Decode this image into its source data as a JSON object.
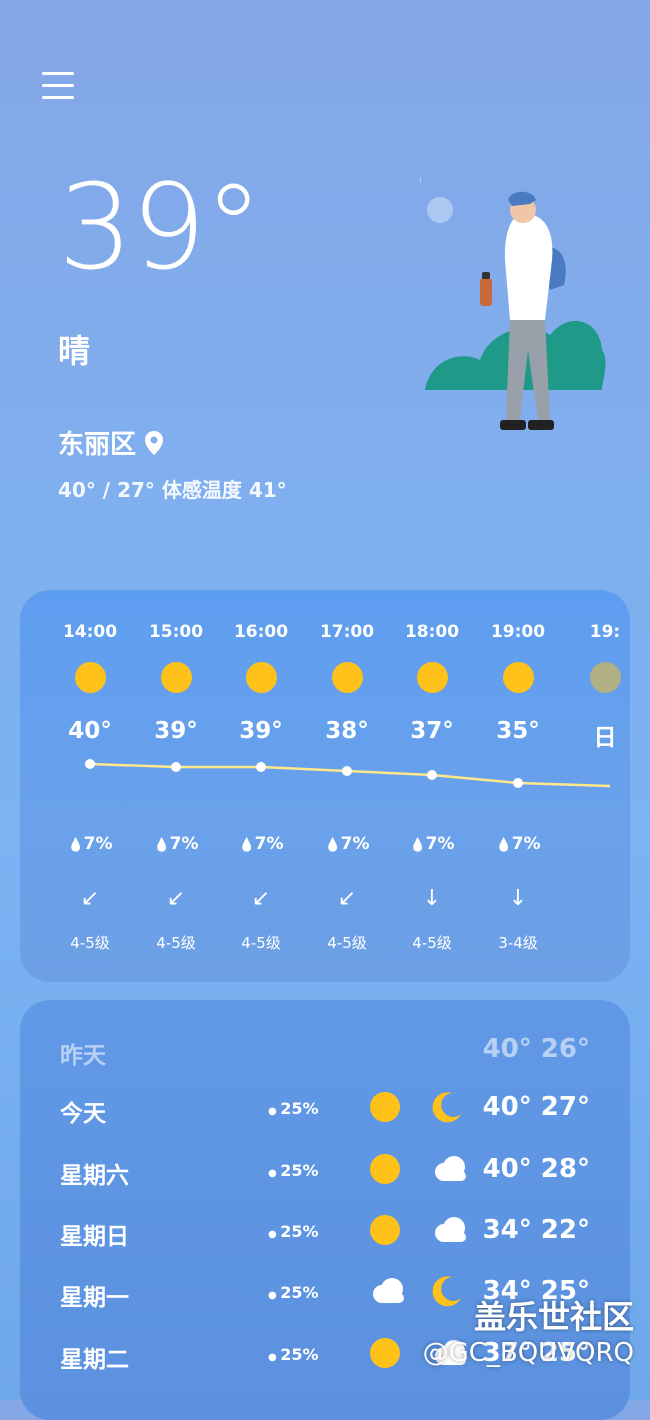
{
  "header": {
    "temperature": "39°",
    "condition": "晴",
    "location": "东丽区",
    "hi_lo_feels": "40° / 27° 体感温度 41°"
  },
  "hourly": [
    {
      "time": "14:00",
      "temp": "40°",
      "rain": "7%",
      "wind_level": "4-5级",
      "wind_dir": "↙",
      "icon": "sun-icon"
    },
    {
      "time": "15:00",
      "temp": "39°",
      "rain": "7%",
      "wind_level": "4-5级",
      "wind_dir": "↙",
      "icon": "sun-icon"
    },
    {
      "time": "16:00",
      "temp": "39°",
      "rain": "7%",
      "wind_level": "4-5级",
      "wind_dir": "↙",
      "icon": "sun-icon"
    },
    {
      "time": "17:00",
      "temp": "38°",
      "rain": "7%",
      "wind_level": "4-5级",
      "wind_dir": "↙",
      "icon": "sun-icon"
    },
    {
      "time": "18:00",
      "temp": "37°",
      "rain": "7%",
      "wind_level": "4-5级",
      "wind_dir": "↓",
      "icon": "sun-icon"
    },
    {
      "time": "19:00",
      "temp": "35°",
      "rain": "7%",
      "wind_level": "3-4级",
      "wind_dir": "↓",
      "icon": "sun-icon"
    },
    {
      "time": "19:",
      "temp": "日",
      "rain": "",
      "wind_level": "",
      "wind_dir": "",
      "icon": "sunset-icon"
    }
  ],
  "daily": [
    {
      "day": "昨天",
      "rain": "",
      "temps": "40° 26°",
      "icon_day": "",
      "icon_night": ""
    },
    {
      "day": "今天",
      "rain": "25%",
      "temps": "40° 27°",
      "icon_day": "sun-icon",
      "icon_night": "moon-icon"
    },
    {
      "day": "星期六",
      "rain": "25%",
      "temps": "40° 28°",
      "icon_day": "sun-icon",
      "icon_night": "cloud-icon"
    },
    {
      "day": "星期日",
      "rain": "25%",
      "temps": "34° 22°",
      "icon_day": "sun-icon",
      "icon_night": "cloud-icon"
    },
    {
      "day": "星期一",
      "rain": "25%",
      "temps": "34° 25°",
      "icon_day": "cloud-icon",
      "icon_night": "moon-icon"
    },
    {
      "day": "星期二",
      "rain": "25%",
      "temps": "37° 25°",
      "icon_day": "sun-icon",
      "icon_night": "cloud-icon"
    }
  ],
  "watermark": {
    "line1": "盖乐世社区",
    "line2": "@GC_BQUVQRQ"
  },
  "colors": {
    "sun": "#ffc21a",
    "line": "#ffe98a",
    "tree": "#1f9a88"
  }
}
